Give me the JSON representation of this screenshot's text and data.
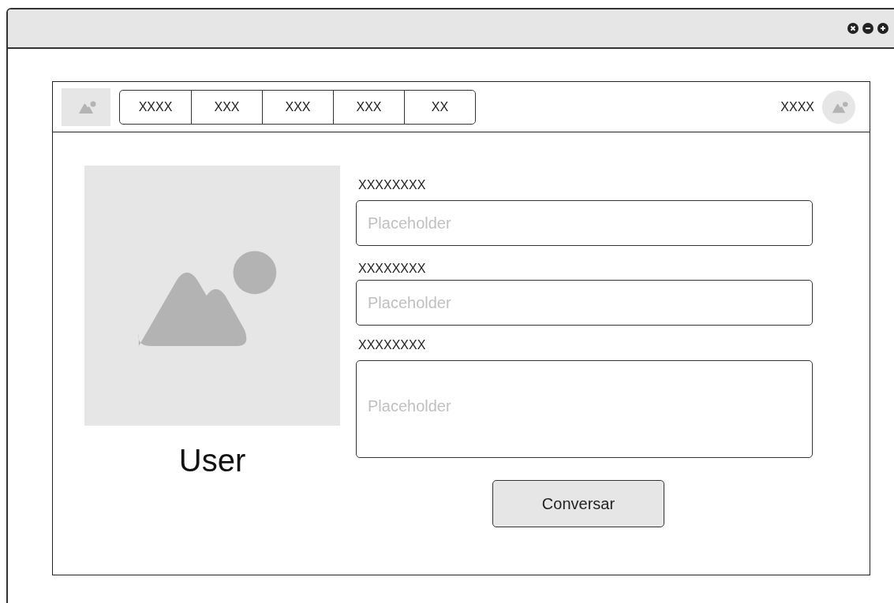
{
  "window": {
    "controls": [
      {
        "kind": "close"
      },
      {
        "kind": "minimize"
      },
      {
        "kind": "maximize"
      }
    ]
  },
  "navbar": {
    "tabs": [
      {
        "label": "XXXX",
        "selected": false
      },
      {
        "label": "XXX",
        "selected": false
      },
      {
        "label": "XXX",
        "selected": false
      },
      {
        "label": "XXX",
        "selected": false
      },
      {
        "label": "XX",
        "selected": false
      }
    ],
    "user_name": "XXXX"
  },
  "profile": {
    "name": "User"
  },
  "form": {
    "fields": [
      {
        "kind": "input",
        "label": "XXXXXXXX",
        "placeholder": "Placeholder"
      },
      {
        "kind": "input",
        "label": "XXXXXXXX",
        "placeholder": "Placeholder"
      },
      {
        "kind": "textarea",
        "label": "XXXXXXXX",
        "placeholder": "Placeholder"
      }
    ],
    "button": "Conversar"
  }
}
